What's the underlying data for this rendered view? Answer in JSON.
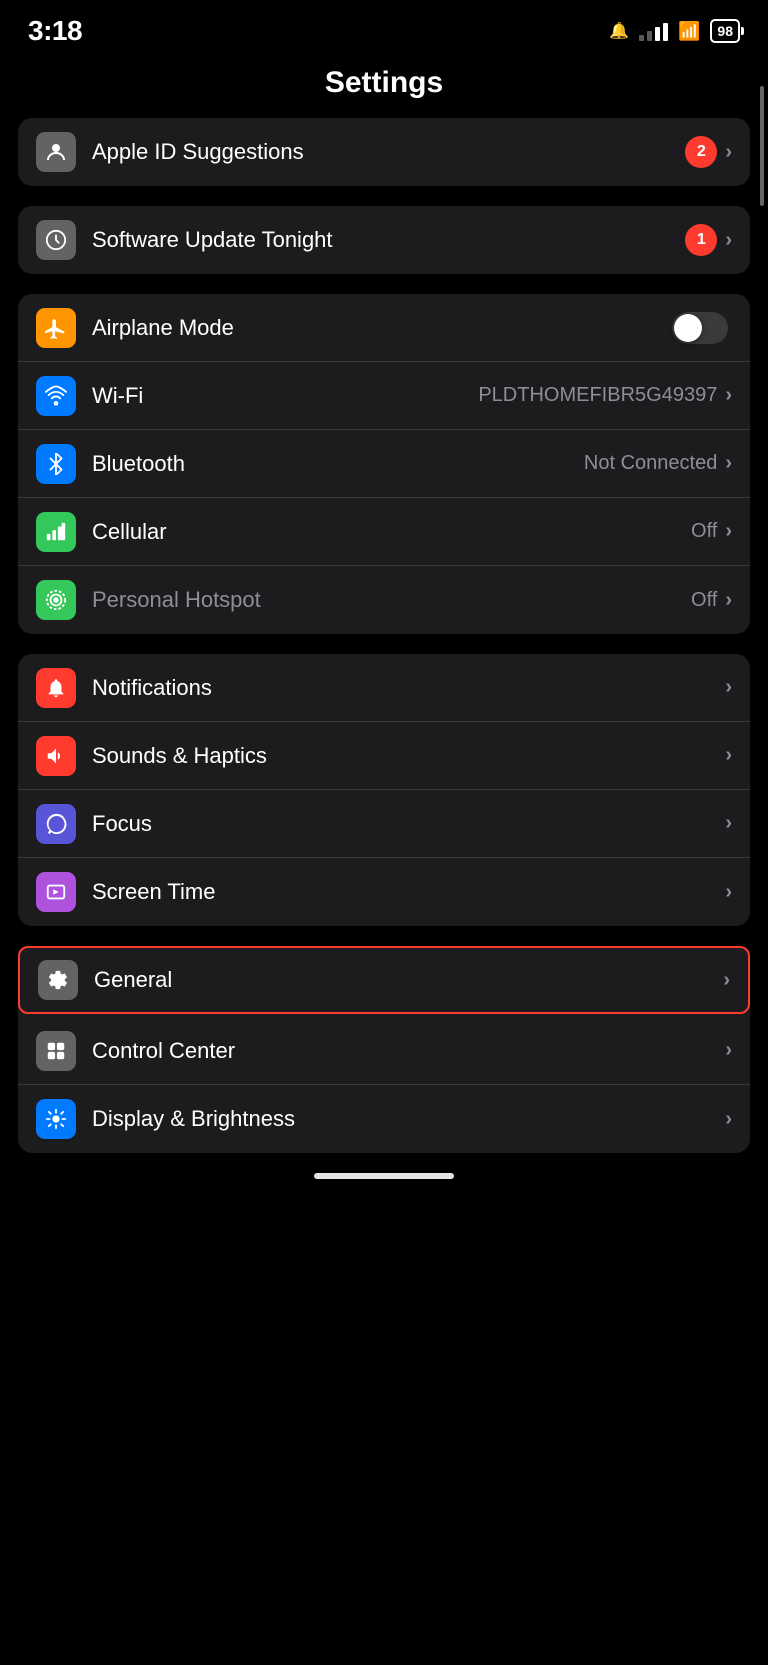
{
  "statusBar": {
    "time": "3:18",
    "batteryPct": "98",
    "notifyIcon": "🔔"
  },
  "pageTitle": "Settings",
  "groups": [
    {
      "id": "suggestions",
      "rows": [
        {
          "id": "apple-id-suggestions",
          "iconBg": "ic-gray2",
          "iconEmoji": "👤",
          "label": "Apple ID Suggestions",
          "value": "",
          "badge": "2",
          "chevron": true,
          "toggle": false,
          "highlighted": false
        }
      ]
    },
    {
      "id": "software-update",
      "rows": [
        {
          "id": "software-update-tonight",
          "iconBg": "ic-gray2",
          "iconEmoji": "⚙️",
          "label": "Software Update Tonight",
          "value": "",
          "badge": "1",
          "chevron": true,
          "toggle": false,
          "highlighted": false
        }
      ]
    },
    {
      "id": "connectivity",
      "rows": [
        {
          "id": "airplane-mode",
          "iconBg": "ic-orange",
          "iconEmoji": "✈️",
          "label": "Airplane Mode",
          "value": "",
          "badge": "",
          "chevron": false,
          "toggle": true,
          "highlighted": false
        },
        {
          "id": "wifi",
          "iconBg": "ic-blue",
          "iconEmoji": "📶",
          "label": "Wi-Fi",
          "value": "PLDTHOMEFIBR5G49397",
          "badge": "",
          "chevron": true,
          "toggle": false,
          "highlighted": false
        },
        {
          "id": "bluetooth",
          "iconBg": "ic-blue2",
          "iconEmoji": "🔷",
          "label": "Bluetooth",
          "value": "Not Connected",
          "badge": "",
          "chevron": true,
          "toggle": false,
          "highlighted": false
        },
        {
          "id": "cellular",
          "iconBg": "ic-green",
          "iconEmoji": "📡",
          "label": "Cellular",
          "value": "Off",
          "badge": "",
          "chevron": true,
          "toggle": false,
          "highlighted": false
        },
        {
          "id": "personal-hotspot",
          "iconBg": "ic-green2",
          "iconEmoji": "🔗",
          "label": "Personal Hotspot",
          "value": "Off",
          "badge": "",
          "chevron": true,
          "toggle": false,
          "highlighted": false
        }
      ]
    },
    {
      "id": "notifications-group",
      "rows": [
        {
          "id": "notifications",
          "iconBg": "ic-red",
          "iconEmoji": "🔔",
          "label": "Notifications",
          "value": "",
          "badge": "",
          "chevron": true,
          "toggle": false,
          "highlighted": false
        },
        {
          "id": "sounds-haptics",
          "iconBg": "ic-red2",
          "iconEmoji": "🔊",
          "label": "Sounds & Haptics",
          "value": "",
          "badge": "",
          "chevron": true,
          "toggle": false,
          "highlighted": false
        },
        {
          "id": "focus",
          "iconBg": "ic-purple",
          "iconEmoji": "🌙",
          "label": "Focus",
          "value": "",
          "badge": "",
          "chevron": true,
          "toggle": false,
          "highlighted": false
        },
        {
          "id": "screen-time",
          "iconBg": "ic-purple2",
          "iconEmoji": "⏱️",
          "label": "Screen Time",
          "value": "",
          "badge": "",
          "chevron": true,
          "toggle": false,
          "highlighted": false
        }
      ]
    },
    {
      "id": "general-group",
      "highlighted": true,
      "rows": [
        {
          "id": "general",
          "iconBg": "ic-gray",
          "iconEmoji": "⚙️",
          "label": "General",
          "value": "",
          "badge": "",
          "chevron": true,
          "toggle": false,
          "highlighted": true
        },
        {
          "id": "control-center",
          "iconBg": "ic-gray2",
          "iconEmoji": "🎛️",
          "label": "Control Center",
          "value": "",
          "badge": "",
          "chevron": true,
          "toggle": false,
          "highlighted": false
        },
        {
          "id": "display-brightness",
          "iconBg": "ic-blue",
          "iconEmoji": "☀️",
          "label": "Display & Brightness",
          "value": "",
          "badge": "",
          "chevron": true,
          "toggle": false,
          "highlighted": false
        }
      ]
    }
  ]
}
